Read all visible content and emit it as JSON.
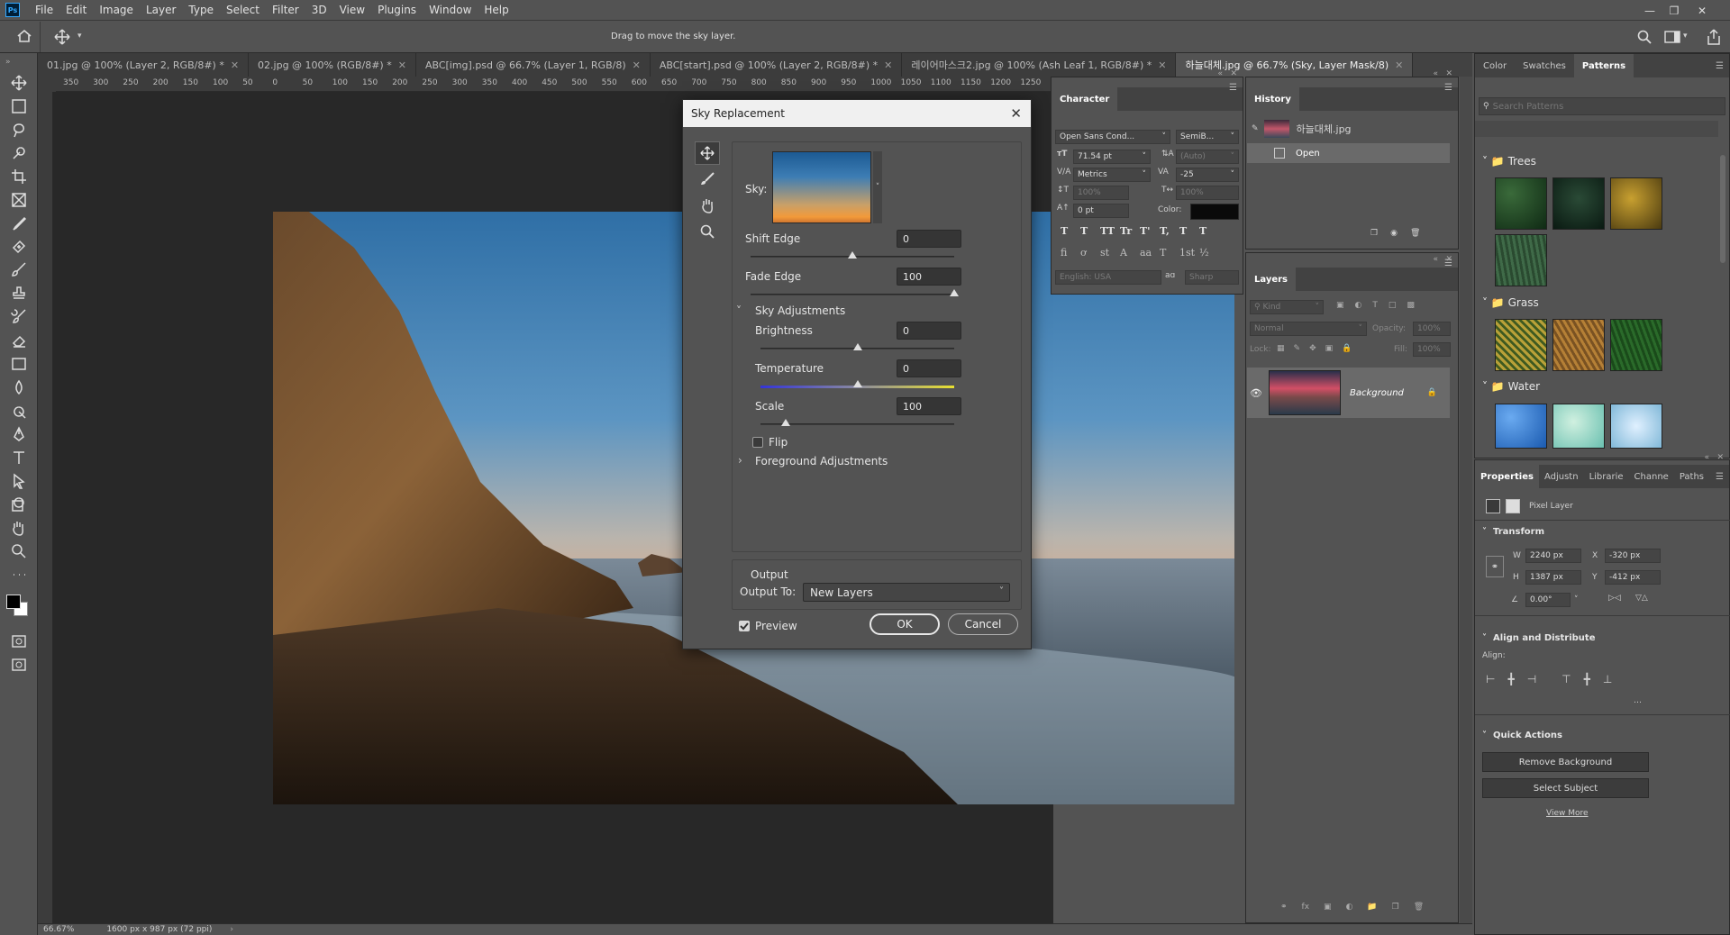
{
  "menubar": {
    "app_icon": "Ps",
    "items": [
      "File",
      "Edit",
      "Image",
      "Layer",
      "Type",
      "Select",
      "Filter",
      "3D",
      "View",
      "Plugins",
      "Window",
      "Help"
    ]
  },
  "options_bar": {
    "hint": "Drag to move the sky layer."
  },
  "tabs": [
    {
      "label": "01.jpg @ 100% (Layer 2, RGB/8#) *"
    },
    {
      "label": "02.jpg @ 100% (RGB/8#) *"
    },
    {
      "label": "ABC[img].psd @ 66.7% (Layer 1, RGB/8)"
    },
    {
      "label": "ABC[start].psd @ 100% (Layer 2, RGB/8#) *"
    },
    {
      "label": "레이어마스크2.jpg @ 100% (Ash Leaf 1, RGB/8#) *"
    },
    {
      "label": "하늘대체.jpg @ 66.7% (Sky, Layer Mask/8)"
    }
  ],
  "ruler": {
    "ticks": [
      "350",
      "300",
      "250",
      "200",
      "150",
      "100",
      "50",
      "0",
      "50",
      "100",
      "150",
      "200",
      "250",
      "300",
      "350",
      "400",
      "450",
      "500",
      "550",
      "600",
      "650",
      "700",
      "750",
      "800",
      "850",
      "900",
      "950",
      "1000",
      "1050",
      "1100",
      "1150",
      "1200",
      "1250"
    ]
  },
  "status": {
    "zoom": "66.67%",
    "doc_size": "1600 px x 987 px (72 ppi)"
  },
  "dialog": {
    "title": "Sky Replacement",
    "sky_label": "Sky:",
    "shift_edge": {
      "label": "Shift Edge",
      "value": "0",
      "level": 0.5
    },
    "fade_edge": {
      "label": "Fade Edge",
      "value": "100",
      "level": 1.0
    },
    "sky_adjustments": "Sky Adjustments",
    "brightness": {
      "label": "Brightness",
      "value": "0",
      "level": 0.5
    },
    "temperature": {
      "label": "Temperature",
      "value": "0",
      "level": 0.5
    },
    "scale": {
      "label": "Scale",
      "value": "100",
      "level": 0.13
    },
    "flip": "Flip",
    "flip_checked": false,
    "foreground_adjustments": "Foreground Adjustments",
    "output_header": "Output",
    "output_to_label": "Output To:",
    "output_to_value": "New Layers",
    "preview": "Preview",
    "preview_checked": true,
    "ok": "OK",
    "cancel": "Cancel"
  },
  "character": {
    "title": "Character",
    "font_family": "Open Sans Cond...",
    "font_style": "SemiB...",
    "size": "71.54 pt",
    "leading": "(Auto)",
    "kerning": "Metrics",
    "tracking": "-25",
    "vscale": "100%",
    "hscale": "100%",
    "baseline": "0 pt",
    "color_label": "Color:",
    "language": "English: USA",
    "aa_label": "aɑ",
    "antialias": "Sharp",
    "style_btns": [
      "T",
      "T",
      "TT",
      "Tr",
      "T'",
      "T,",
      "T",
      "T"
    ],
    "ot_btns": [
      "fi",
      "ơ",
      "st",
      "A",
      "aa",
      "T",
      "1st",
      "½"
    ]
  },
  "history": {
    "title": "History",
    "snapshot": "하늘대체.jpg",
    "step": "Open"
  },
  "layers": {
    "title": "Layers",
    "kind": "Kind",
    "blend": "Normal",
    "opacity_label": "Opacity:",
    "opacity": "100%",
    "lock_label": "Lock:",
    "fill_label": "Fill:",
    "fill": "100%",
    "layer_name": "Background"
  },
  "libraries": {
    "tabs": [
      "Color",
      "Swatches",
      "Patterns"
    ],
    "search_placeholder": "Search Patterns",
    "groups": [
      "Trees",
      "Grass",
      "Water"
    ]
  },
  "properties": {
    "tabs": [
      "Properties",
      "Adjustn",
      "Librarie",
      "Channe",
      "Paths"
    ],
    "type": "Pixel Layer",
    "transform": "Transform",
    "w_label": "W",
    "w": "2240 px",
    "h_label": "H",
    "h": "1387 px",
    "x_label": "X",
    "x": "-320 px",
    "y_label": "Y",
    "y": "-412 px",
    "angle": "0.00°",
    "align_distribute": "Align and Distribute",
    "align_label": "Align:",
    "quick_actions": "Quick Actions",
    "remove_bg": "Remove Background",
    "select_subject": "Select Subject",
    "view_more": "View More"
  },
  "colors": {
    "accent": "#31a8ff",
    "panel": "#535353",
    "dark": "#282828"
  }
}
